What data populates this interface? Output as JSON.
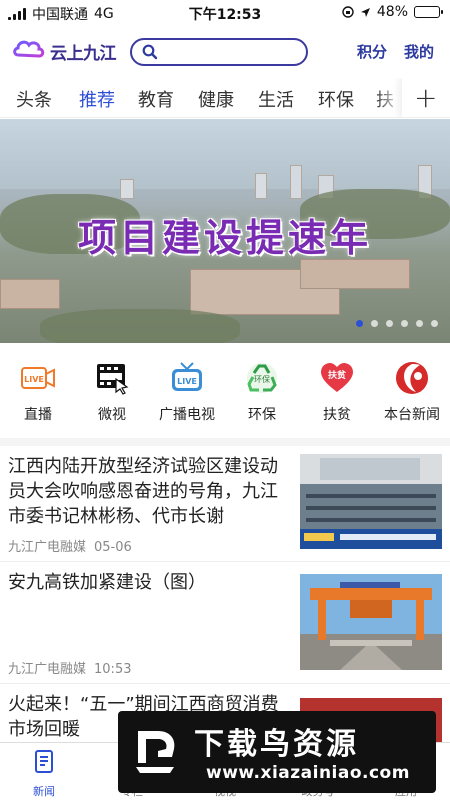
{
  "status_bar": {
    "carrier": "中国联通",
    "network": "4G",
    "time": "下午12:53",
    "battery": "48%",
    "battery_level": 0.48
  },
  "header": {
    "logo_text": "云上九江",
    "search_placeholder": "",
    "points": "积分",
    "mine": "我的"
  },
  "tabs": [
    "头条",
    "推荐",
    "教育",
    "健康",
    "生活",
    "环保",
    "扶"
  ],
  "active_tab": "推荐",
  "banner": {
    "title": "项目建设提速年",
    "slide_count": 6,
    "active_slide": 1
  },
  "shortcuts": [
    {
      "label": "直播",
      "icon": "live-camera-icon"
    },
    {
      "label": "微视",
      "icon": "video-clapper-icon"
    },
    {
      "label": "广播电视",
      "icon": "live-tv-icon"
    },
    {
      "label": "环保",
      "icon": "recycle-icon"
    },
    {
      "label": "扶贫",
      "icon": "poverty-relief-heart-icon"
    },
    {
      "label": "本台新闻",
      "icon": "station-logo-icon"
    }
  ],
  "news": [
    {
      "title": "江西内陆开放型经济试验区建设动员大会吹响感恩奋进的号角，九江市委书记林彬杨、代市长谢",
      "source": "九江广电融媒",
      "time": "05-06",
      "thumb": "conference-photo"
    },
    {
      "title": "安九高铁加紧建设（图）",
      "source": "九江广电融媒",
      "time": "10:53",
      "thumb": "railway-construction-photo"
    },
    {
      "title": "火起来！“五一”期间江西商贸消费市场回暖",
      "source": "",
      "time": "",
      "thumb": ""
    }
  ],
  "bottom_nav": [
    {
      "label": "新闻",
      "icon": "news-icon",
      "active": true
    },
    {
      "label": "专栏",
      "icon": "column-icon",
      "active": false
    },
    {
      "label": "视视",
      "icon": "video-icon",
      "active": false
    },
    {
      "label": "政务号",
      "icon": "gov-icon",
      "active": false
    },
    {
      "label": "应用",
      "icon": "apps-icon",
      "active": false
    }
  ],
  "watermark": {
    "title": "下载鸟资源",
    "url": "www.xiazainiao.com"
  },
  "colors": {
    "accent": "#2d4fd6",
    "brand": "#3a2f8f",
    "banner_title": "#7a2bb3"
  }
}
